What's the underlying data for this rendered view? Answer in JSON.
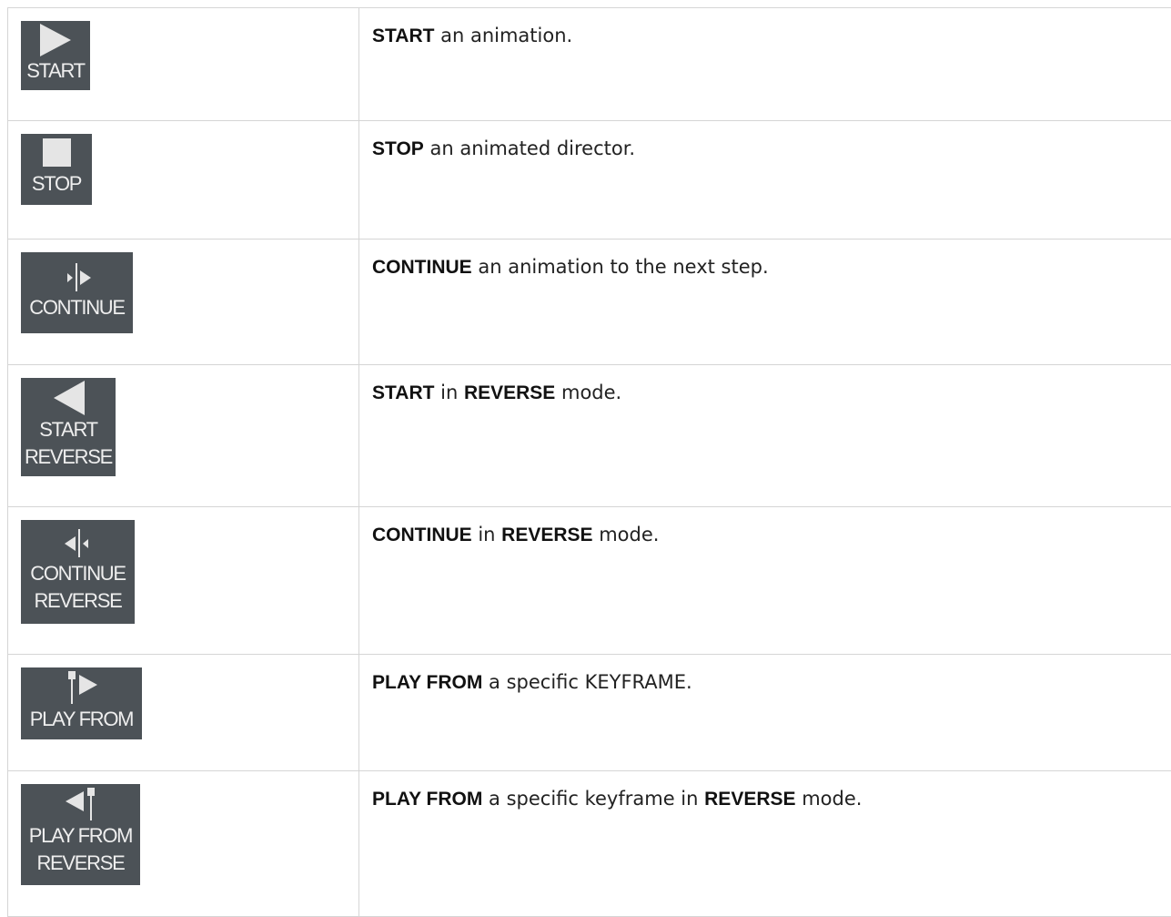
{
  "colors": {
    "button_bg": "#4c5257",
    "icon_fill": "#e5e5e5",
    "border": "#d5d5d5"
  },
  "rows": [
    {
      "icon": "play-icon",
      "button_lines": [
        "START"
      ],
      "desc": [
        {
          "t": "START",
          "b": true
        },
        {
          "t": " an animation.",
          "b": false
        }
      ]
    },
    {
      "icon": "stop-icon",
      "button_lines": [
        "STOP"
      ],
      "desc": [
        {
          "t": "STOP",
          "b": true
        },
        {
          "t": " an animated director.",
          "b": false
        }
      ]
    },
    {
      "icon": "continue-icon",
      "button_lines": [
        "CONTINUE"
      ],
      "desc": [
        {
          "t": "CONTINUE",
          "b": true
        },
        {
          "t": " an animation to the next step.",
          "b": false
        }
      ]
    },
    {
      "icon": "reverse-play-icon",
      "button_lines": [
        "START",
        "REVERSE"
      ],
      "desc": [
        {
          "t": "START",
          "b": true
        },
        {
          "t": " in ",
          "b": false
        },
        {
          "t": "REVERSE",
          "b": true
        },
        {
          "t": " mode.",
          "b": false
        }
      ]
    },
    {
      "icon": "continue-reverse-icon",
      "button_lines": [
        "CONTINUE",
        "REVERSE"
      ],
      "desc": [
        {
          "t": "CONTINUE",
          "b": true
        },
        {
          "t": " in ",
          "b": false
        },
        {
          "t": "REVERSE",
          "b": true
        },
        {
          "t": " mode.",
          "b": false
        }
      ]
    },
    {
      "icon": "play-from-icon",
      "button_lines": [
        "PLAY FROM"
      ],
      "desc": [
        {
          "t": "PLAY FROM",
          "b": true
        },
        {
          "t": " a specific KEYFRAME.",
          "b": false
        }
      ]
    },
    {
      "icon": "play-from-reverse-icon",
      "button_lines": [
        "PLAY FROM",
        "REVERSE"
      ],
      "desc": [
        {
          "t": "PLAY FROM",
          "b": true
        },
        {
          "t": " a specific keyframe in ",
          "b": false
        },
        {
          "t": "REVERSE",
          "b": true
        },
        {
          "t": " mode.",
          "b": false
        }
      ]
    }
  ]
}
